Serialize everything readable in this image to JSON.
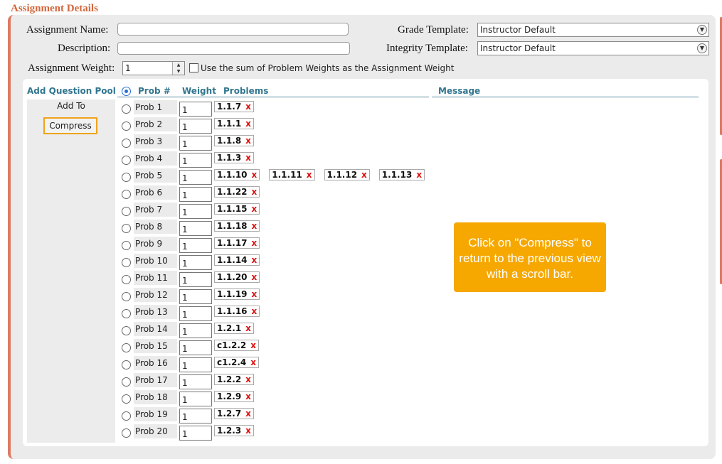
{
  "page": {
    "title": "Assignment Details"
  },
  "form": {
    "assignment_name_label": "Assignment Name:",
    "assignment_name_value": "",
    "description_label": "Description:",
    "description_value": "",
    "grade_template_label": "Grade Template:",
    "grade_template_value": "Instructor Default",
    "integrity_template_label": "Integrity Template:",
    "integrity_template_value": "Instructor Default",
    "weight_label": "Assignment Weight:",
    "weight_value": "1",
    "sum_weights_label": "Use the sum of Problem Weights as the Assignment Weight",
    "sum_weights_checked": false
  },
  "table": {
    "headers": {
      "add_pool": "Add Question Pool",
      "prob_num": "Prob #",
      "weight": "Weight",
      "problems": "Problems",
      "message": "Message"
    },
    "pool": {
      "add_to": "Add To",
      "compress": "Compress"
    },
    "rows": [
      {
        "label": "Prob 1",
        "weight": "1",
        "problems": [
          "1.1.7"
        ]
      },
      {
        "label": "Prob 2",
        "weight": "1",
        "problems": [
          "1.1.1"
        ]
      },
      {
        "label": "Prob 3",
        "weight": "1",
        "problems": [
          "1.1.8"
        ]
      },
      {
        "label": "Prob 4",
        "weight": "1",
        "problems": [
          "1.1.3"
        ]
      },
      {
        "label": "Prob 5",
        "weight": "1",
        "problems": [
          "1.1.10",
          "1.1.11",
          "1.1.12",
          "1.1.13"
        ]
      },
      {
        "label": "Prob 6",
        "weight": "1",
        "problems": [
          "1.1.22"
        ]
      },
      {
        "label": "Prob 7",
        "weight": "1",
        "problems": [
          "1.1.15"
        ]
      },
      {
        "label": "Prob 8",
        "weight": "1",
        "problems": [
          "1.1.18"
        ]
      },
      {
        "label": "Prob 9",
        "weight": "1",
        "problems": [
          "1.1.17"
        ]
      },
      {
        "label": "Prob 10",
        "weight": "1",
        "problems": [
          "1.1.14"
        ]
      },
      {
        "label": "Prob 11",
        "weight": "1",
        "problems": [
          "1.1.20"
        ]
      },
      {
        "label": "Prob 12",
        "weight": "1",
        "problems": [
          "1.1.19"
        ]
      },
      {
        "label": "Prob 13",
        "weight": "1",
        "problems": [
          "1.1.16"
        ]
      },
      {
        "label": "Prob 14",
        "weight": "1",
        "problems": [
          "1.2.1"
        ]
      },
      {
        "label": "Prob 15",
        "weight": "1",
        "problems": [
          "c1.2.2"
        ]
      },
      {
        "label": "Prob 16",
        "weight": "1",
        "problems": [
          "c1.2.4"
        ]
      },
      {
        "label": "Prob 17",
        "weight": "1",
        "problems": [
          "1.2.2"
        ]
      },
      {
        "label": "Prob 18",
        "weight": "1",
        "problems": [
          "1.2.9"
        ]
      },
      {
        "label": "Prob 19",
        "weight": "1",
        "problems": [
          "1.2.7"
        ]
      },
      {
        "label": "Prob 20",
        "weight": "1",
        "problems": [
          "1.2.3"
        ]
      }
    ],
    "remove_glyph": "x"
  },
  "callout": {
    "text": "Click on \"Compress\" to return to the previous view with a scroll bar."
  },
  "colors": {
    "accent": "#dc7a62",
    "header_text": "#31768f",
    "callout_bg": "#f6a800",
    "remove": "#d11111"
  },
  "icons": {
    "dropdown": "chevron-down-icon",
    "remove": "remove-x-icon"
  }
}
